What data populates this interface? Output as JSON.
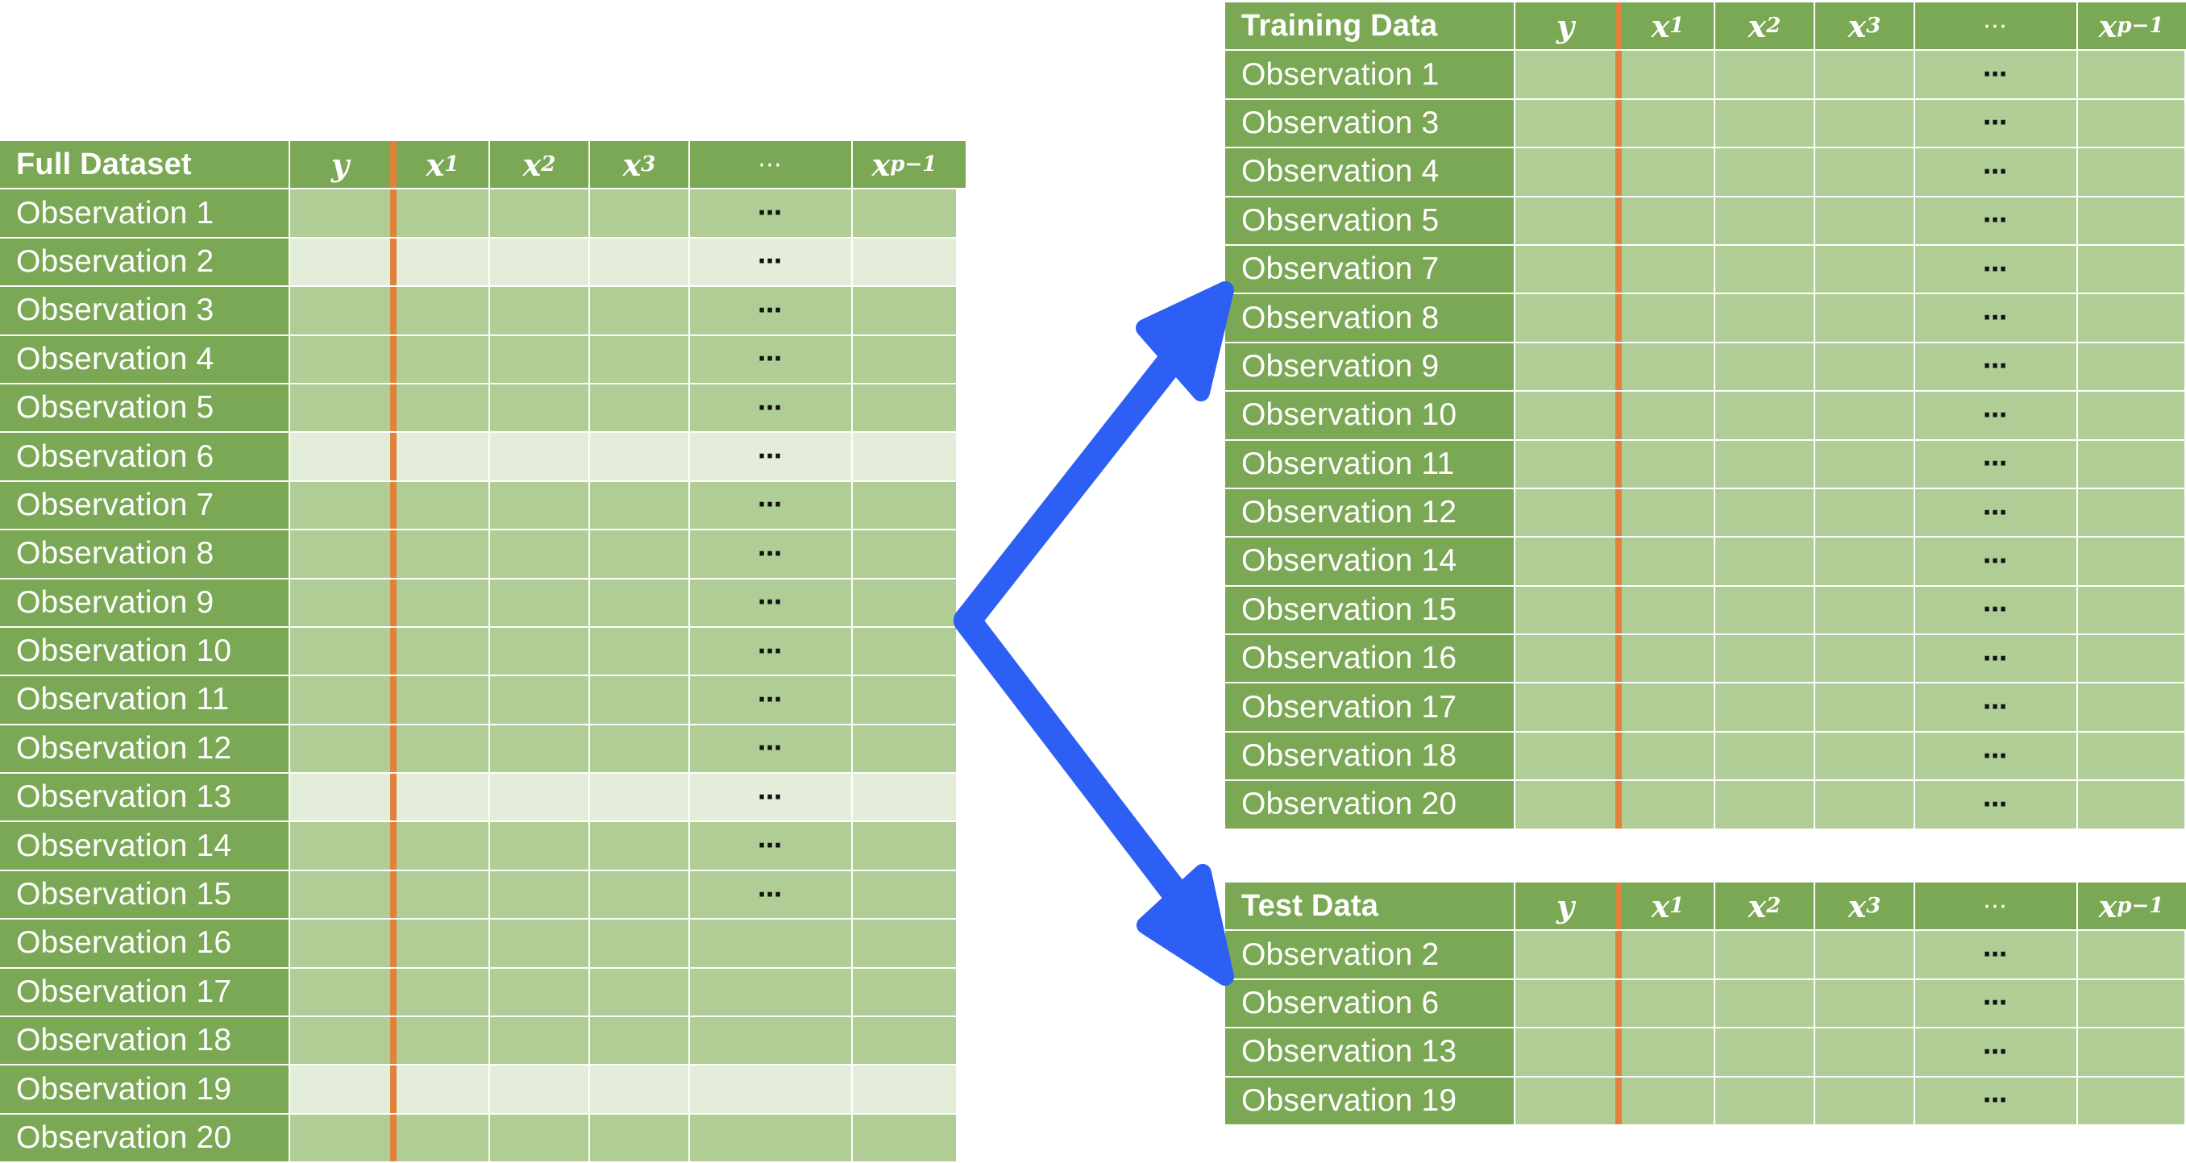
{
  "columns": {
    "y": "y",
    "x1": "x",
    "x1_sub": "1",
    "x2": "x",
    "x2_sub": "2",
    "x3": "x",
    "x3_sub": "3",
    "ellipsis": "⋯",
    "xp": "x",
    "xp_sub": "p−1",
    "row_dots": "⋯"
  },
  "full": {
    "title": "Full Dataset",
    "rows": [
      {
        "label": "Observation 1",
        "test": false,
        "dots": true
      },
      {
        "label": "Observation 2",
        "test": true,
        "dots": true
      },
      {
        "label": "Observation 3",
        "test": false,
        "dots": true
      },
      {
        "label": "Observation 4",
        "test": false,
        "dots": true
      },
      {
        "label": "Observation 5",
        "test": false,
        "dots": true
      },
      {
        "label": "Observation 6",
        "test": true,
        "dots": true
      },
      {
        "label": "Observation 7",
        "test": false,
        "dots": true
      },
      {
        "label": "Observation 8",
        "test": false,
        "dots": true
      },
      {
        "label": "Observation 9",
        "test": false,
        "dots": true
      },
      {
        "label": "Observation 10",
        "test": false,
        "dots": true
      },
      {
        "label": "Observation 11",
        "test": false,
        "dots": true
      },
      {
        "label": "Observation 12",
        "test": false,
        "dots": true
      },
      {
        "label": "Observation 13",
        "test": true,
        "dots": true
      },
      {
        "label": "Observation 14",
        "test": false,
        "dots": true
      },
      {
        "label": "Observation 15",
        "test": false,
        "dots": true
      },
      {
        "label": "Observation 16",
        "test": false,
        "dots": false
      },
      {
        "label": "Observation 17",
        "test": false,
        "dots": false
      },
      {
        "label": "Observation 18",
        "test": false,
        "dots": false
      },
      {
        "label": "Observation 19",
        "test": true,
        "dots": false
      },
      {
        "label": "Observation 20",
        "test": false,
        "dots": false
      }
    ]
  },
  "training": {
    "title": "Training Data",
    "rows": [
      {
        "label": "Observation 1"
      },
      {
        "label": "Observation 3"
      },
      {
        "label": "Observation 4"
      },
      {
        "label": "Observation 5"
      },
      {
        "label": "Observation 7"
      },
      {
        "label": "Observation 8"
      },
      {
        "label": "Observation 9"
      },
      {
        "label": "Observation 10"
      },
      {
        "label": "Observation 11"
      },
      {
        "label": "Observation 12"
      },
      {
        "label": "Observation 14"
      },
      {
        "label": "Observation 15"
      },
      {
        "label": "Observation 16"
      },
      {
        "label": "Observation 17"
      },
      {
        "label": "Observation 18"
      },
      {
        "label": "Observation 20"
      }
    ]
  },
  "test": {
    "title": "Test Data",
    "rows": [
      {
        "label": "Observation 2"
      },
      {
        "label": "Observation 6"
      },
      {
        "label": "Observation 13"
      },
      {
        "label": "Observation 19"
      }
    ]
  },
  "colors": {
    "header_green": "#7ba854",
    "cell_green": "#afcd94",
    "cell_light": "#e4edd9",
    "divider_orange": "#e0823c",
    "arrow_blue": "#2d5ff5"
  }
}
